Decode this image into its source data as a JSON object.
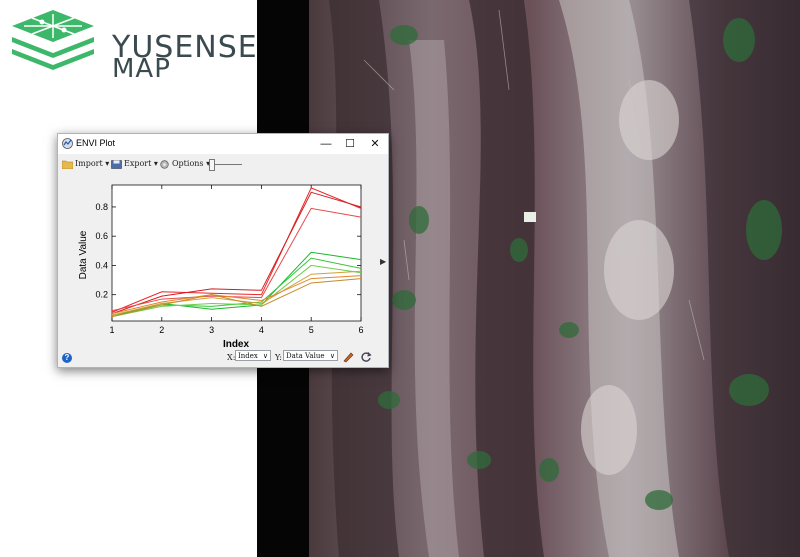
{
  "brand": {
    "line1": "YUSENSE",
    "line2": "MAP",
    "logo_color": "#3db86a"
  },
  "window": {
    "title": "ENVI Plot",
    "controls": {
      "minimize": "—",
      "maximize": "☐",
      "close": "✕"
    }
  },
  "toolbar": {
    "import_label": "Import",
    "export_label": "Export",
    "options_label": "Options"
  },
  "statusbar": {
    "x_label": "X:",
    "x_value": "Index",
    "y_label": "Y:",
    "y_value": "Data Value"
  },
  "chart_data": {
    "type": "line",
    "xlabel": "Index",
    "ylabel": "Data Value",
    "x": [
      1,
      2,
      3,
      4,
      5,
      6
    ],
    "xlim": [
      1,
      6
    ],
    "ylim": [
      0.02,
      0.95
    ],
    "xticks": [
      1,
      2,
      3,
      4,
      5,
      6
    ],
    "yticks": [
      0.2,
      0.4,
      0.6,
      0.8
    ],
    "grid": false,
    "series": [
      {
        "color": "#e8272b",
        "values": [
          0.08,
          0.22,
          0.21,
          0.2,
          0.93,
          0.79
        ]
      },
      {
        "color": "#d21e1e",
        "values": [
          0.07,
          0.19,
          0.24,
          0.23,
          0.9,
          0.8
        ]
      },
      {
        "color": "#e84848",
        "values": [
          0.09,
          0.17,
          0.19,
          0.18,
          0.79,
          0.73
        ]
      },
      {
        "color": "#19b82a",
        "values": [
          0.05,
          0.14,
          0.1,
          0.13,
          0.49,
          0.44
        ]
      },
      {
        "color": "#36c43a",
        "values": [
          0.06,
          0.13,
          0.12,
          0.15,
          0.45,
          0.38
        ]
      },
      {
        "color": "#6bcf4a",
        "values": [
          0.05,
          0.12,
          0.14,
          0.13,
          0.4,
          0.35
        ]
      },
      {
        "color": "#d4a03a",
        "values": [
          0.06,
          0.14,
          0.18,
          0.14,
          0.34,
          0.36
        ]
      },
      {
        "color": "#e0862c",
        "values": [
          0.07,
          0.15,
          0.2,
          0.16,
          0.31,
          0.33
        ]
      },
      {
        "color": "#c48a2a",
        "values": [
          0.05,
          0.13,
          0.2,
          0.12,
          0.28,
          0.31
        ]
      }
    ]
  }
}
